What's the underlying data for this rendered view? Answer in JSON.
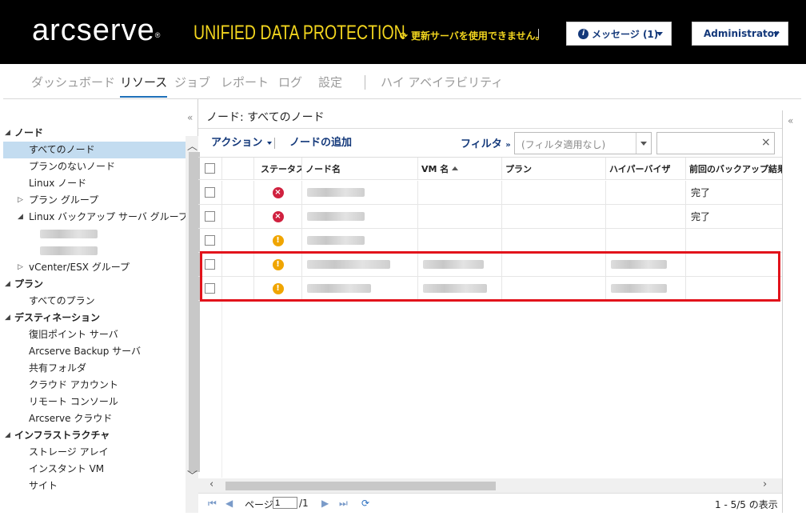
{
  "header": {
    "logo": "arcserve",
    "logo_mark": "®",
    "product": "UNIFIED DATA PROTECTION",
    "update_message": "更新サーバを使用できません。",
    "messages_button": "メッセージ (1)",
    "user_button": "Administrator"
  },
  "nav": {
    "tabs": [
      "ダッシュボード",
      "リソース",
      "ジョブ",
      "レポート",
      "ログ",
      "設定",
      "ハイ アベイラビリティ"
    ]
  },
  "sidebar": {
    "sections": [
      {
        "label": "ノード",
        "items": [
          "すべてのノード",
          "プランのないノード",
          "Linux ノード",
          "プラン グループ",
          "Linux バックアップ サーバ グループ",
          "vCenter/ESX グループ"
        ]
      },
      {
        "label": "プラン",
        "items": [
          "すべてのプラン"
        ]
      },
      {
        "label": "デスティネーション",
        "items": [
          "復旧ポイント サーバ",
          "Arcserve Backup サーバ",
          "共有フォルダ",
          "クラウド アカウント",
          "リモート コンソール",
          "Arcserve クラウド"
        ]
      },
      {
        "label": "インフラストラクチャ",
        "items": [
          "ストレージ アレイ",
          "インスタント VM",
          "サイト"
        ]
      }
    ]
  },
  "main": {
    "title": "ノード: すべてのノード",
    "toolbar": {
      "actions": "アクション",
      "add_node": "ノードの追加",
      "filter": "フィルタ",
      "filter_select": "(フィルタ適用なし)",
      "search_value": ""
    },
    "columns": [
      "ステータス",
      "ノード名",
      "VM 名",
      "プラン",
      "ハイパーバイザ",
      "前回のバックアップ結果"
    ],
    "rows": [
      {
        "status": "error",
        "last_result": "完了"
      },
      {
        "status": "error",
        "last_result": "完了"
      },
      {
        "status": "warning",
        "last_result": ""
      },
      {
        "status": "warning",
        "last_result": ""
      },
      {
        "status": "warning",
        "last_result": ""
      }
    ],
    "pager": {
      "page_label": "ページ",
      "page_value": "1",
      "page_total": "/1",
      "summary": "1 - 5/5 の表示"
    }
  },
  "colors": {
    "header_bg": "#000000",
    "accent_yellow": "#f2d51e",
    "link_blue": "#13387a",
    "error": "#d0213f",
    "warning": "#f0a500",
    "highlight": "#e2131b"
  }
}
